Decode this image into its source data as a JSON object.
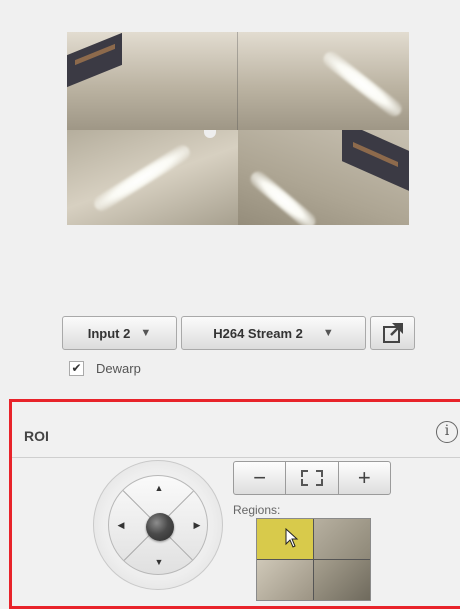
{
  "stream": {
    "input_select": "Input 2",
    "stream_select": "H264 Stream 2",
    "dewarp_label": "Dewarp",
    "dewarp_checked": true
  },
  "roi": {
    "title": "ROI",
    "regions_label": "Regions:",
    "zoom_out_label": "−",
    "zoom_in_label": "+"
  },
  "colors": {
    "highlight": "#e8232a",
    "selected_region": "#d8ca4b"
  },
  "icons": {
    "popout": "external-window-icon",
    "info": "info-icon",
    "fit": "fit-to-window-icon",
    "check": "checkmark-icon"
  }
}
